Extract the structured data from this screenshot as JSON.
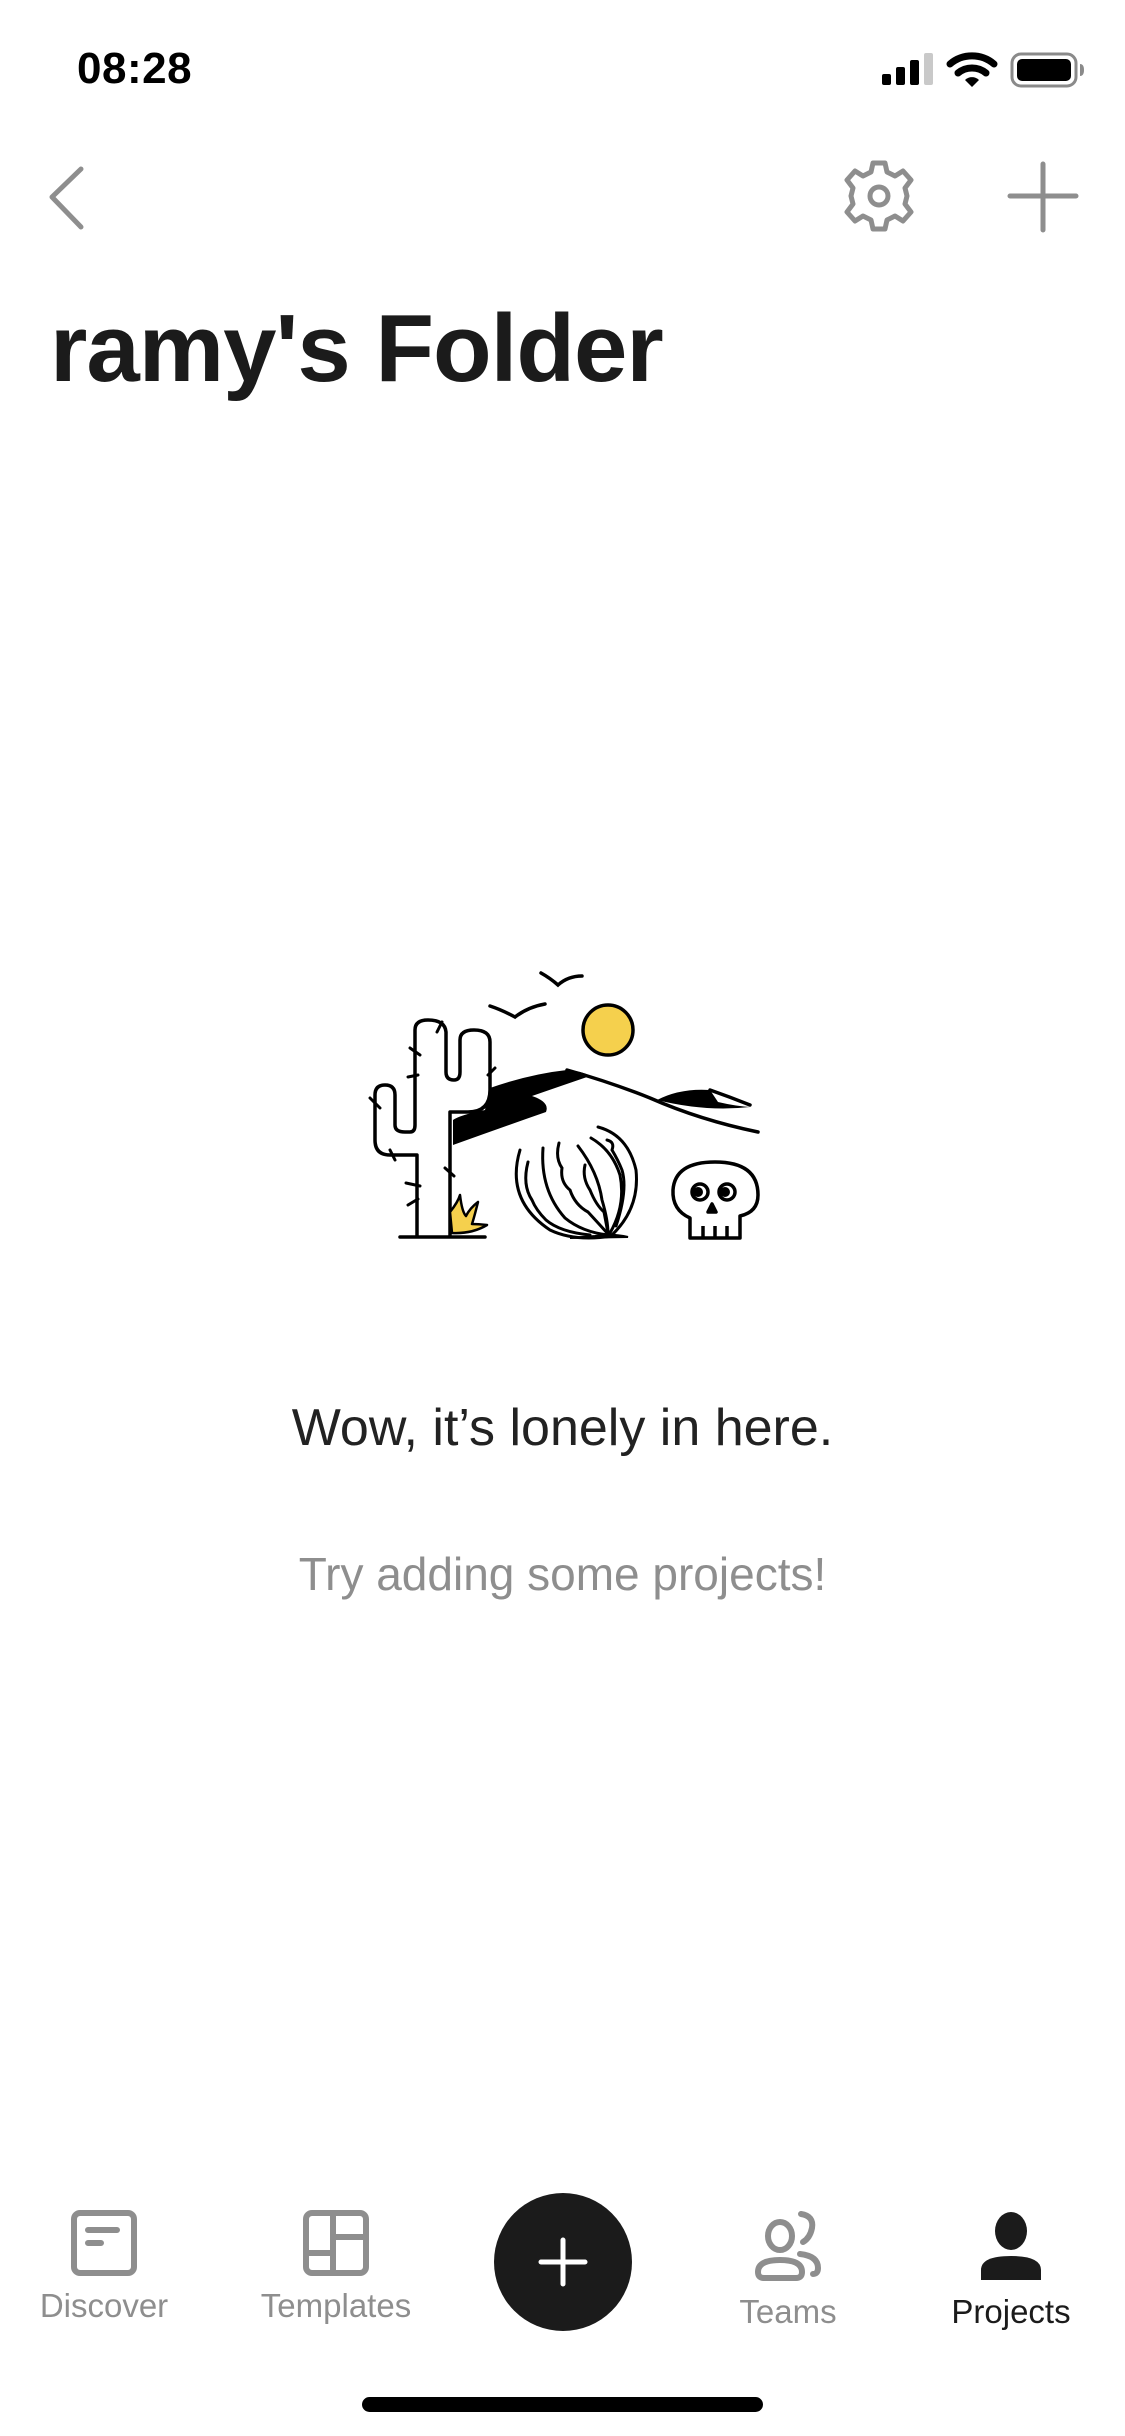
{
  "status_bar": {
    "time": "08:28",
    "signal_bars_active": 3,
    "signal_bars_total": 4,
    "wifi_icon": "wifi-icon",
    "battery_icon": "battery-full-icon"
  },
  "nav": {
    "back_icon": "chevron-left-icon",
    "settings_icon": "gear-icon",
    "add_icon": "plus-icon",
    "title": "ramy's Folder"
  },
  "empty_state": {
    "illustration": "desert-cactus-tumbleweed-skull",
    "title": "Wow, it’s lonely in here.",
    "subtitle": "Try adding some projects!"
  },
  "tab_bar": {
    "tabs": [
      {
        "label": "Discover",
        "icon": "discover-icon",
        "active": false
      },
      {
        "label": "Templates",
        "icon": "templates-icon",
        "active": false
      },
      {
        "label": "Teams",
        "icon": "teams-icon",
        "active": false
      },
      {
        "label": "Projects",
        "icon": "person-icon",
        "active": true
      }
    ],
    "create_button_icon": "plus-icon"
  },
  "colors": {
    "primary_text": "#1b1b1b",
    "secondary_text": "#8e8e8e",
    "icon_gray": "#8e8e8e",
    "accent_yellow": "#f5d04d",
    "background": "#ffffff"
  }
}
